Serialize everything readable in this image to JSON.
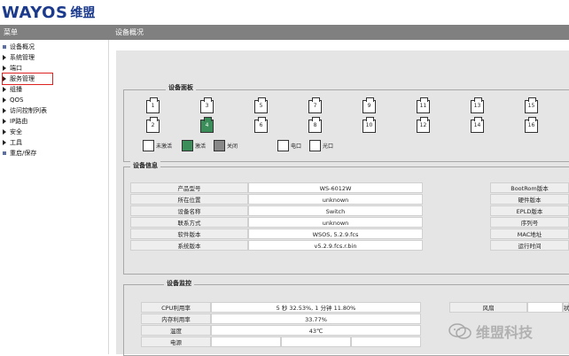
{
  "brand": {
    "logo_text": "WAYOS",
    "logo_cn": "维盟"
  },
  "titlebar": {
    "menu_title": "菜单",
    "page_title": "设备概况"
  },
  "sidebar": {
    "items": [
      {
        "label": "设备概况",
        "icon": "square"
      },
      {
        "label": "系统管理",
        "icon": "arrow"
      },
      {
        "label": "端口",
        "icon": "arrow"
      },
      {
        "label": "服务管理",
        "icon": "arrow"
      },
      {
        "label": "组播",
        "icon": "arrow"
      },
      {
        "label": "QOS",
        "icon": "arrow"
      },
      {
        "label": "访问控制列表",
        "icon": "arrow"
      },
      {
        "label": "IP路由",
        "icon": "arrow"
      },
      {
        "label": "安全",
        "icon": "arrow"
      },
      {
        "label": "工具",
        "icon": "arrow"
      },
      {
        "label": "重启/保存",
        "icon": "square"
      }
    ]
  },
  "device_panel": {
    "title": "设备面板",
    "ports_top": [
      "1",
      "3",
      "5",
      "7",
      "9",
      "11",
      "13",
      "15"
    ],
    "ports_bottom": [
      "2",
      "4",
      "6",
      "8",
      "10",
      "12",
      "14",
      "16"
    ],
    "legend": {
      "inactive": "未激活",
      "active": "激活",
      "closed": "关闭",
      "electric": "电口",
      "optical": "光口"
    }
  },
  "device_info": {
    "title": "设备信息",
    "left_rows": [
      {
        "label": "产品型号",
        "value": "WS-6012W"
      },
      {
        "label": "所在位置",
        "value": "unknown"
      },
      {
        "label": "设备名称",
        "value": "Switch"
      },
      {
        "label": "联系方式",
        "value": "unknown"
      },
      {
        "label": "软件版本",
        "value": "WSOS, 5.2.9.fcs"
      },
      {
        "label": "系统版本",
        "value": "v5.2.9.fcs.r.bin"
      }
    ],
    "right_rows": [
      {
        "label": "BootRom版本"
      },
      {
        "label": "硬件版本"
      },
      {
        "label": "EPLD版本"
      },
      {
        "label": "序列号"
      },
      {
        "label": "MAC地址"
      },
      {
        "label": "运行时间"
      }
    ]
  },
  "device_monitor": {
    "title": "设备监控",
    "rows": [
      {
        "label": "CPU利用率",
        "value": "5 秒 32.53%, 1 分钟 11.80%"
      },
      {
        "label": "内存利用率",
        "value": "33.77%"
      },
      {
        "label": "温度",
        "value": "43℃"
      },
      {
        "label": "电源",
        "value": ""
      }
    ],
    "right_labels": {
      "fan": "风扇",
      "extra": "状"
    }
  },
  "watermark": {
    "text": "维盟科技"
  },
  "colors": {
    "brand": "#1b3a8c",
    "active_port": "#3b8e5a",
    "titlebar": "#808080",
    "highlight": "#dd2222"
  }
}
